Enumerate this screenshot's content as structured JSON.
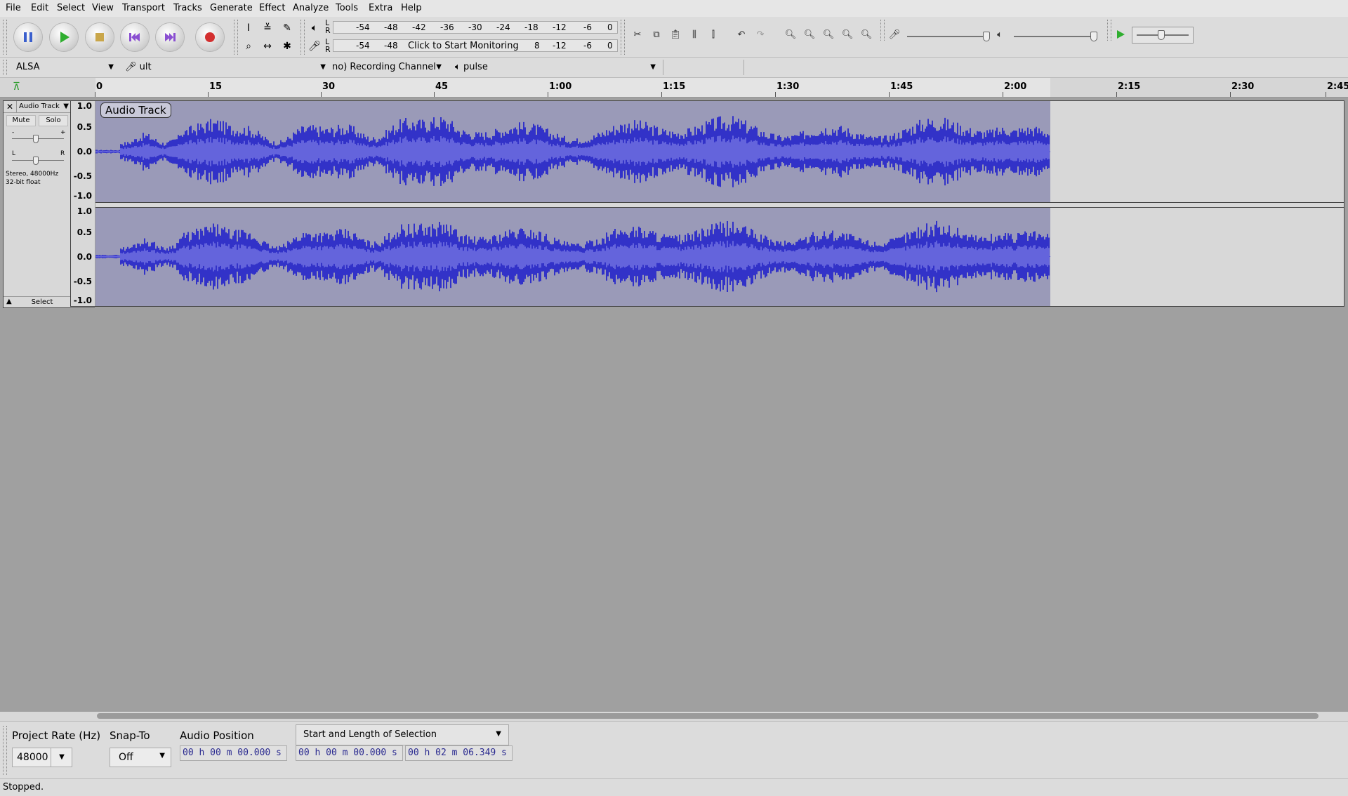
{
  "menu": [
    "File",
    "Edit",
    "Select",
    "View",
    "Transport",
    "Tracks",
    "Generate",
    "Effect",
    "Analyze",
    "Tools",
    "Extra",
    "Help"
  ],
  "meters": {
    "record_scale": [
      "-54",
      "-48",
      "-42",
      "-36",
      "-30",
      "-24",
      "-18",
      "-12",
      "-6",
      "0"
    ],
    "play_scale_left": [
      "-54",
      "-48"
    ],
    "play_scale_right": [
      "8",
      "-12",
      "-6",
      "0"
    ],
    "monitor_label": "Click to Start Monitoring",
    "lr": [
      "L",
      "R"
    ]
  },
  "devices": {
    "host": "ALSA",
    "recording_device": "ult",
    "recording_channels": "no) Recording Channel",
    "playback_device": "pulse"
  },
  "timeline": [
    "0",
    "15",
    "30",
    "45",
    "1:00",
    "1:15",
    "1:30",
    "1:45",
    "2:00",
    "2:15",
    "2:30",
    "2:45"
  ],
  "track": {
    "name": "Audio Track",
    "title_label": "Audio Track",
    "mute": "Mute",
    "solo": "Solo",
    "gain_minus": "-",
    "gain_plus": "+",
    "pan_left": "L",
    "pan_right": "R",
    "info_line1": "Stereo, 48000Hz",
    "info_line2": "32-bit float",
    "select": "Select",
    "ruler": [
      "1.0",
      "0.5",
      "0.0",
      "-0.5",
      "-1.0"
    ]
  },
  "selection_toolbar": {
    "project_rate_label": "Project Rate (Hz)",
    "project_rate_value": "48000",
    "snap_to_label": "Snap-To",
    "snap_to_value": "Off",
    "audio_position_label": "Audio Position",
    "audio_position_value": "00 h 00 m 00.000 s",
    "selection_mode": "Start and Length of Selection",
    "selection_start": "00 h 00 m 00.000 s",
    "selection_length": "00 h 02 m 06.349 s"
  },
  "status": "Stopped.",
  "colors": {
    "waveform": "#3232c8",
    "waveform_rms": "#6464dc",
    "track_bg_selected": "#9a9ab8"
  }
}
